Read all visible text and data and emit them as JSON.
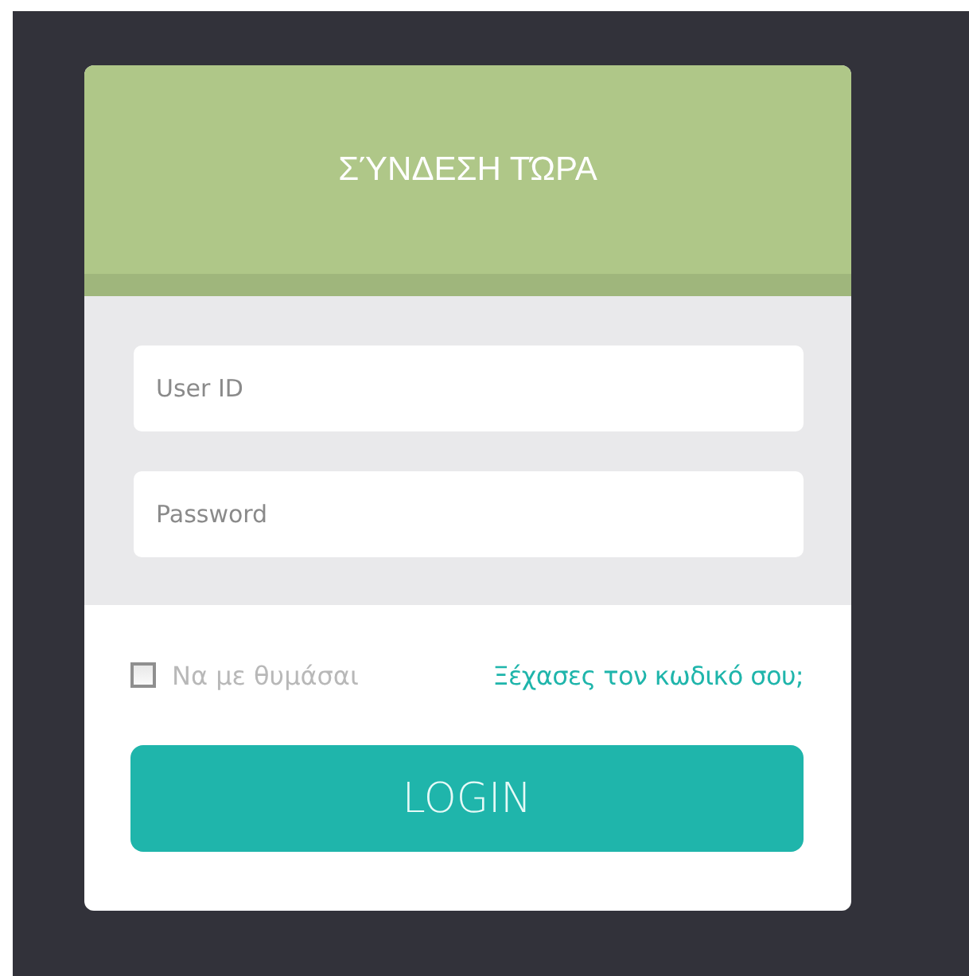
{
  "login_panel": {
    "title": "ΣΎΝΔΕΣΗ ΤΏΡΑ",
    "fields": [
      {
        "placeholder": "User ID"
      },
      {
        "placeholder": "Password"
      }
    ],
    "remember_me": {
      "label": "Να με θυμάσαι",
      "checked": false
    },
    "forgot_link": "Ξέχασες τον κωδικό σου;",
    "button": "LOGIN"
  }
}
